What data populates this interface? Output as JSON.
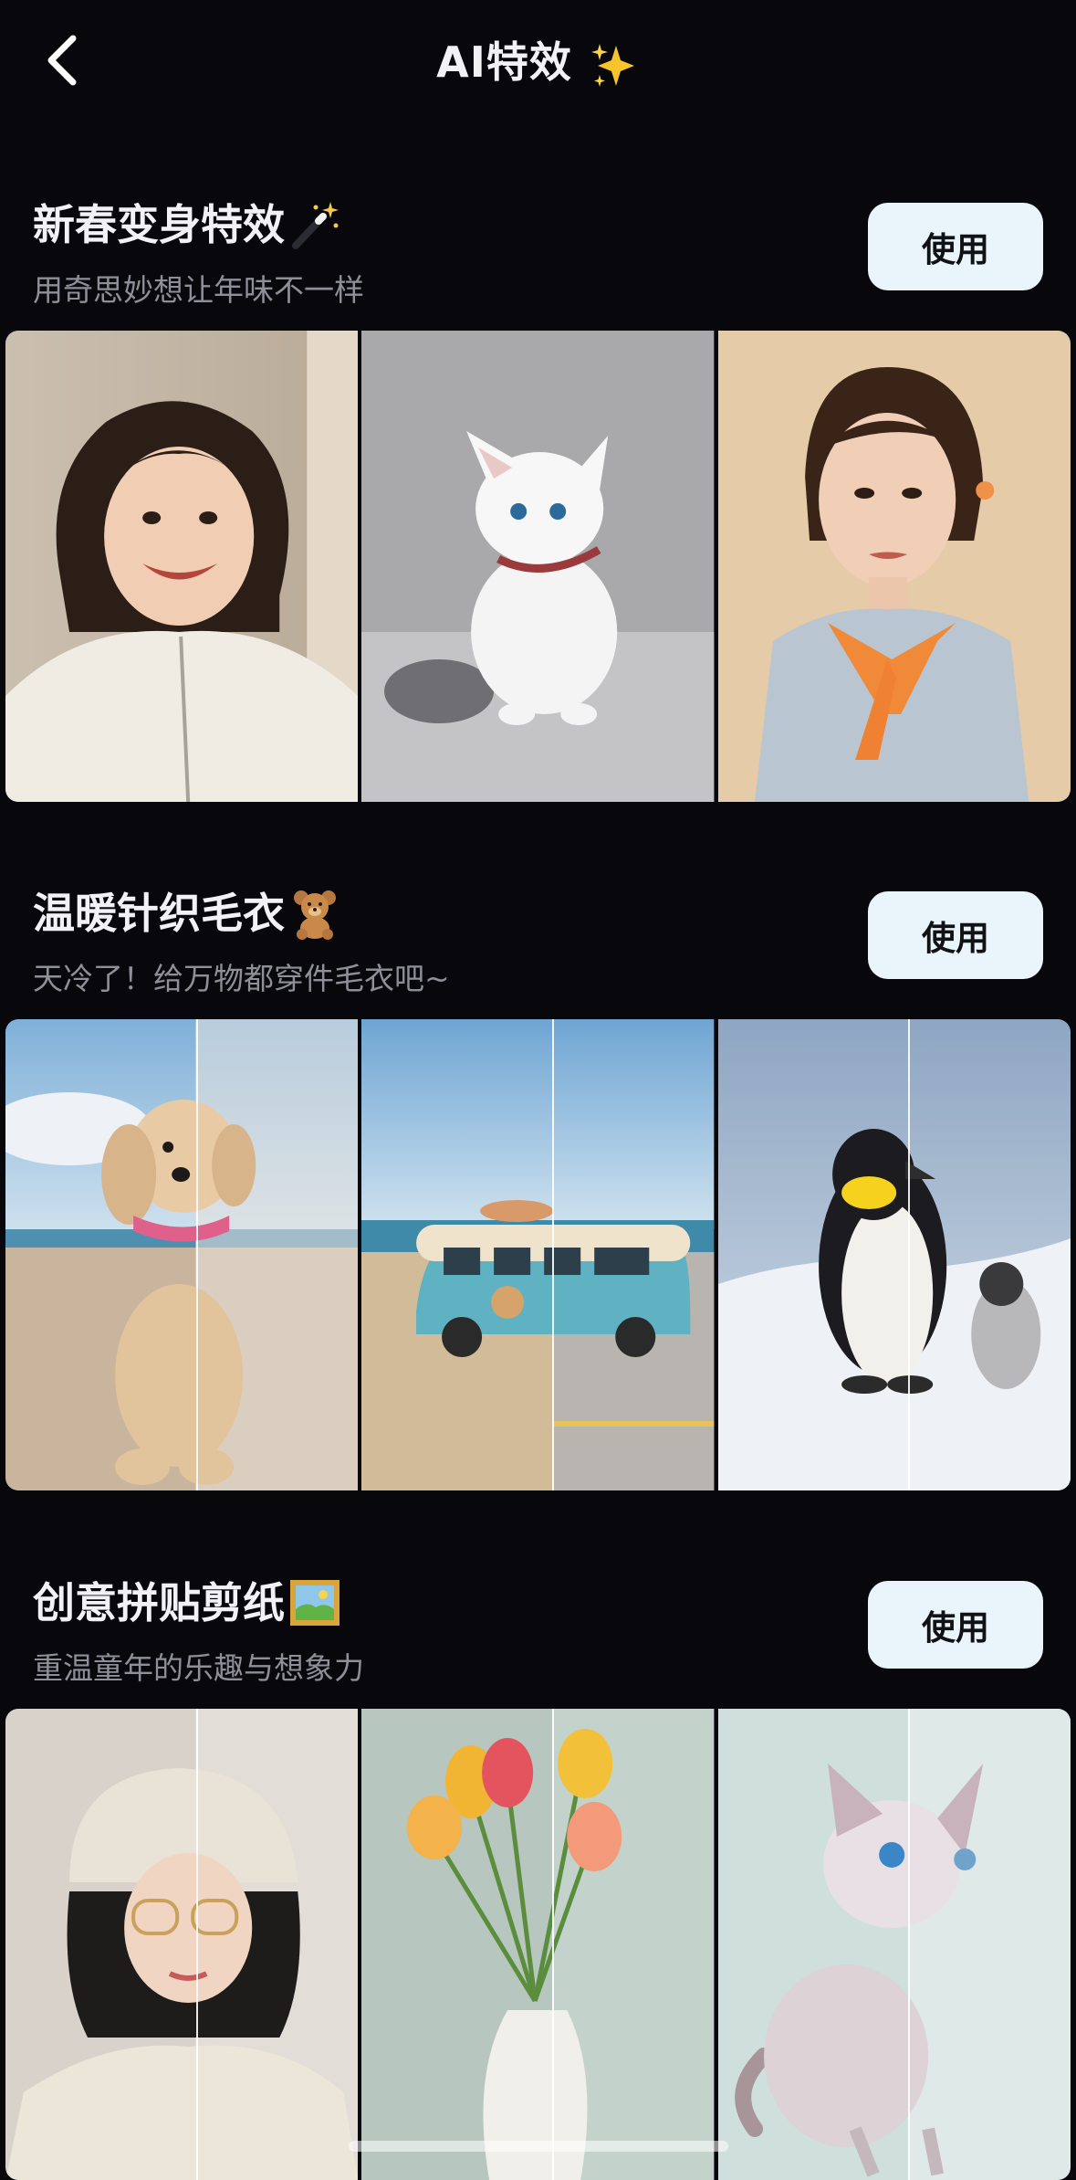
{
  "header": {
    "title": "AI特效",
    "back_icon": "chevron-left-icon",
    "title_icon": "sparkles-icon"
  },
  "sections": [
    {
      "title": "新春变身特效",
      "emoji": "magic-wand-icon",
      "subtitle": "用奇思妙想让年味不一样",
      "button_label": "使用",
      "tiles": [
        "smiling-girl-photo",
        "white-kitten-photo",
        "woman-portrait-photo"
      ]
    },
    {
      "title": "温暖针织毛衣",
      "emoji": "teddy-bear-icon",
      "subtitle": "天冷了！给万物都穿件毛衣吧~",
      "button_label": "使用",
      "tiles": [
        "knitted-dog-photo",
        "knitted-van-photo",
        "knitted-penguin-photo"
      ]
    },
    {
      "title": "创意拼贴剪纸",
      "emoji": "framed-picture-icon",
      "subtitle": "重温童年的乐趣与想象力",
      "button_label": "使用",
      "tiles": [
        "paper-girl-photo",
        "paper-tulips-photo",
        "paper-cat-photo"
      ]
    }
  ],
  "colors": {
    "background": "#07070c",
    "button_bg": "#e9f5fb",
    "subtitle": "#8e8f98"
  }
}
